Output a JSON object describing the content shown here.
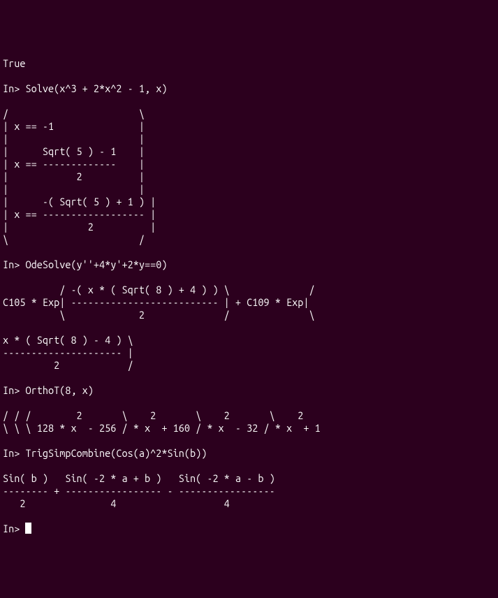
{
  "terminal": {
    "lines": [
      "True",
      "",
      "In> Solve(x^3 + 2*x^2 - 1, x)",
      "",
      "/                       \\",
      "| x == -1               |",
      "|                       |",
      "|      Sqrt( 5 ) - 1    |",
      "| x == -------------    |",
      "|            2          |",
      "|                       |",
      "|      -( Sqrt( 5 ) + 1 ) |",
      "| x == ------------------ |",
      "|              2          |",
      "\\                       /",
      "",
      "In> OdeSolve(y''+4*y'+2*y==0)",
      "",
      "          / -( x * ( Sqrt( 8 ) + 4 ) ) \\              /",
      "C105 * Exp| -------------------------- | + C109 * Exp|",
      "          \\             2              /              \\",
      "",
      "x * ( Sqrt( 8 ) - 4 ) \\",
      "--------------------- |",
      "         2            /",
      "",
      "In> OrthoT(8, x)",
      "",
      "/ / /        2       \\    2       \\    2       \\    2",
      "\\ \\ \\ 128 * x  - 256 / * x  + 160 / * x  - 32 / * x  + 1",
      "",
      "In> TrigSimpCombine(Cos(a)^2*Sin(b))",
      "",
      "Sin( b )   Sin( -2 * a + b )   Sin( -2 * a - b )",
      "-------- + ----------------- - -----------------",
      "   2               4                   4",
      ""
    ],
    "prompt": "In> "
  }
}
